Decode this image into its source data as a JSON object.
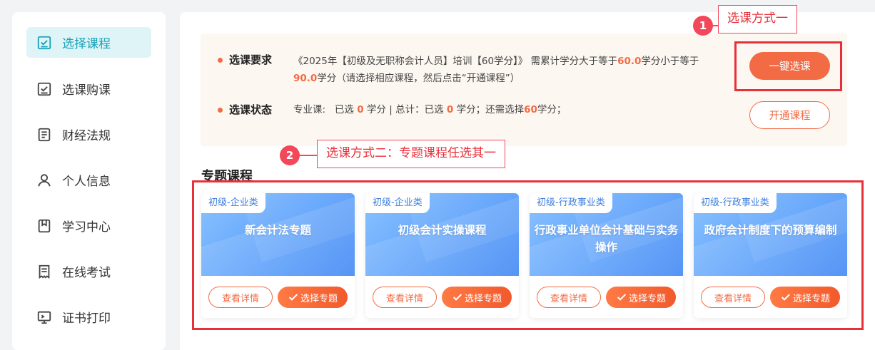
{
  "sidebar": {
    "items": [
      {
        "label": "选择课程",
        "icon": "checkbox-icon",
        "active": true
      },
      {
        "label": "选课购课",
        "icon": "checkbox-icon",
        "active": false
      },
      {
        "label": "财经法规",
        "icon": "document-icon",
        "active": false
      },
      {
        "label": "个人信息",
        "icon": "user-icon",
        "active": false
      },
      {
        "label": "学习中心",
        "icon": "bookmark-icon",
        "active": false
      },
      {
        "label": "在线考试",
        "icon": "exam-icon",
        "active": false
      },
      {
        "label": "证书打印",
        "icon": "certificate-icon",
        "active": false
      }
    ]
  },
  "requirement": {
    "label": "选课要求",
    "text_part1": "《2025年【初级及无职称会计人员】培训【60学分】》 需累计学分大于等于",
    "min_credit": "60.0",
    "text_part2": "学分小于等于",
    "max_credit": "90.0",
    "text_part3": "学分（请选择相应课程，然后点击“开通课程”）"
  },
  "status": {
    "label": "选课状态",
    "professional_prefix": "专业课:   已选",
    "professional_selected": "0",
    "total_prefix": "学分 | 总计：已选",
    "total_selected": "0",
    "remaining_prefix": "学分；还需选择",
    "remaining": "60",
    "remaining_suffix": "学分；"
  },
  "buttons": {
    "one_key": "一键选课",
    "open": "开通课程"
  },
  "section_title": "专题课程",
  "courses": [
    {
      "tag": "初级-企业类",
      "title": "新会计法专题",
      "detail": "查看详情",
      "select": "选择专题"
    },
    {
      "tag": "初级-企业类",
      "title": "初级会计实操课程",
      "detail": "查看详情",
      "select": "选择专题"
    },
    {
      "tag": "初级-行政事业类",
      "title": "行政事业单位会计基础与实务操作",
      "detail": "查看详情",
      "select": "选择专题"
    },
    {
      "tag": "初级-行政事业类",
      "title": "政府会计制度下的预算编制",
      "detail": "查看详情",
      "select": "选择专题"
    }
  ],
  "annotations": {
    "one": {
      "number": "1",
      "label": "选课方式一"
    },
    "two": {
      "number": "2",
      "label": "选课方式二：专题课程任选其一"
    }
  },
  "colors": {
    "accent": "#f26b45",
    "active_nav": "#17a2b8",
    "annotation_red": "#e8303a",
    "card_blue": "#5ea2fb"
  }
}
